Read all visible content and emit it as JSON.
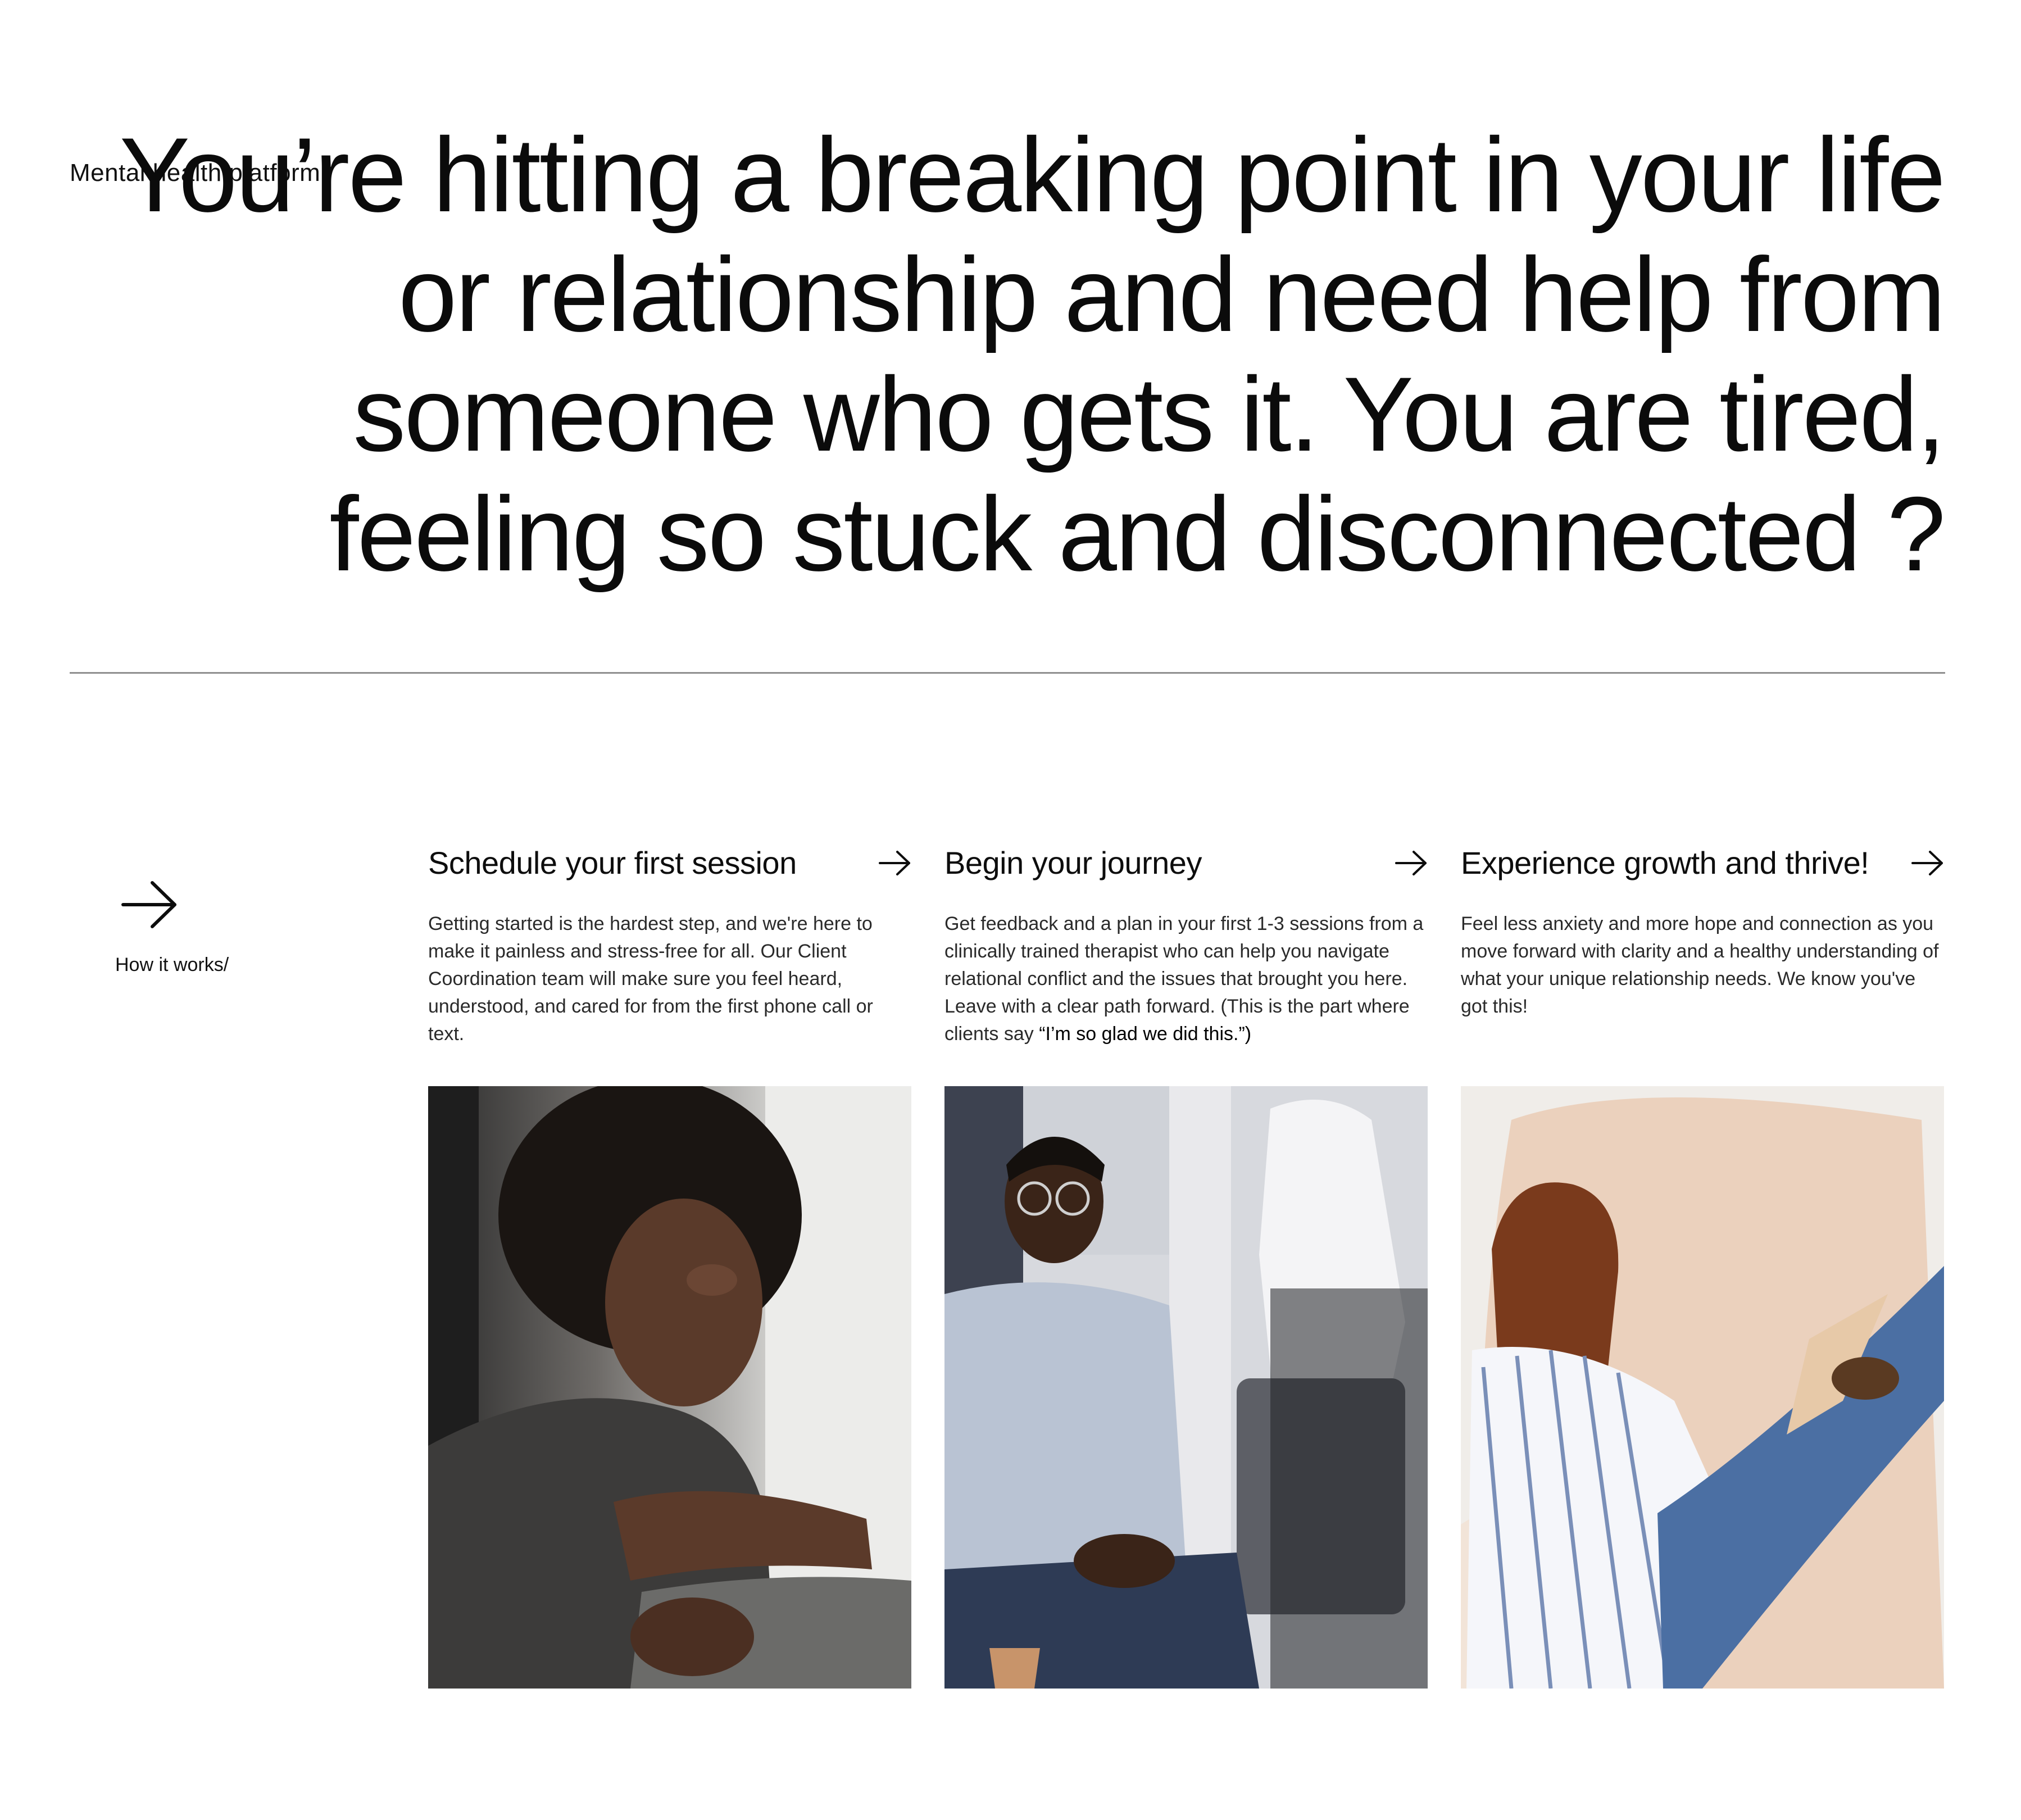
{
  "header": {
    "eyebrow": "Mental health platform",
    "headline": "You’re hitting a breaking point in your life or relationship and need help from someone who gets it. You are tired, feeling so stuck and disconnected ?"
  },
  "how_it_works": {
    "label": "How it works/",
    "icon": "arrow-right-icon"
  },
  "steps": [
    {
      "title": "Schedule your first session",
      "description": "Getting started is the hardest step, and we're here to make it painless and stress-free for all. Our Client Coordination team will make sure you feel heard, understood, and cared for from the first phone call or text.",
      "quote": "",
      "icon": "arrow-right-icon",
      "image": "woman-looking-out-window-photo"
    },
    {
      "title": "Begin your journey",
      "description": "Get feedback and a plan in your first 1-3 sessions from a clinically trained therapist who can help you navigate relational conflict and the issues that brought you here. Leave with a clear path forward. (This is the part where clients say",
      "quote": "“I’m so glad we did this.”)",
      "icon": "arrow-right-icon",
      "image": "man-in-therapy-session-photo"
    },
    {
      "title": "Experience growth and thrive!",
      "description": "Feel less anxiety and more hope and connection as you move forward with clarity and a healthy understanding of what your unique relationship needs. We know you've got this!",
      "quote": "",
      "icon": "arrow-right-icon",
      "image": "woman-reading-in-chair-photo"
    }
  ],
  "colors": {
    "text": "#0d0d0d",
    "body_text": "#2a2a2a",
    "divider": "#8f8f8f",
    "background": "#ffffff"
  }
}
